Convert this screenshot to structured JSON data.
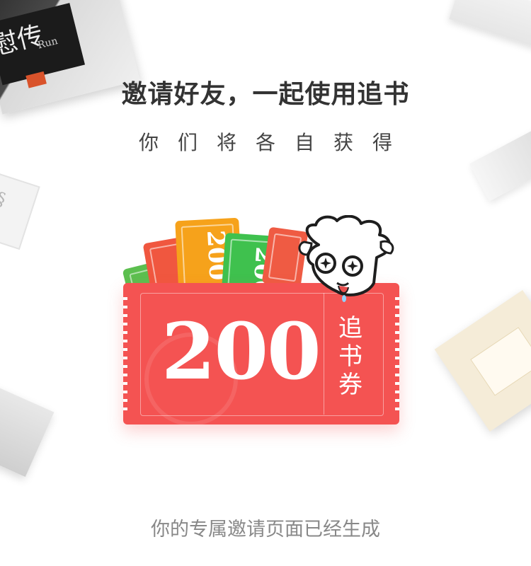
{
  "header": {
    "headline": "邀请好友，一起使用追书",
    "subline": "你们将各自获得"
  },
  "coupon": {
    "amount": "200",
    "label": "追书券",
    "mini_amount": "200",
    "colors": {
      "ticket": "#f45352",
      "mini_green": "#3fc14e",
      "mini_orange": "#f6a21b",
      "mini_red": "#ef5b43"
    },
    "illustration_icon": "sheep-mascot-icon"
  },
  "decor_book": {
    "title": "慰传",
    "subtitle": "Run"
  },
  "footer": {
    "status": "你的专属邀请页面已经生成"
  }
}
